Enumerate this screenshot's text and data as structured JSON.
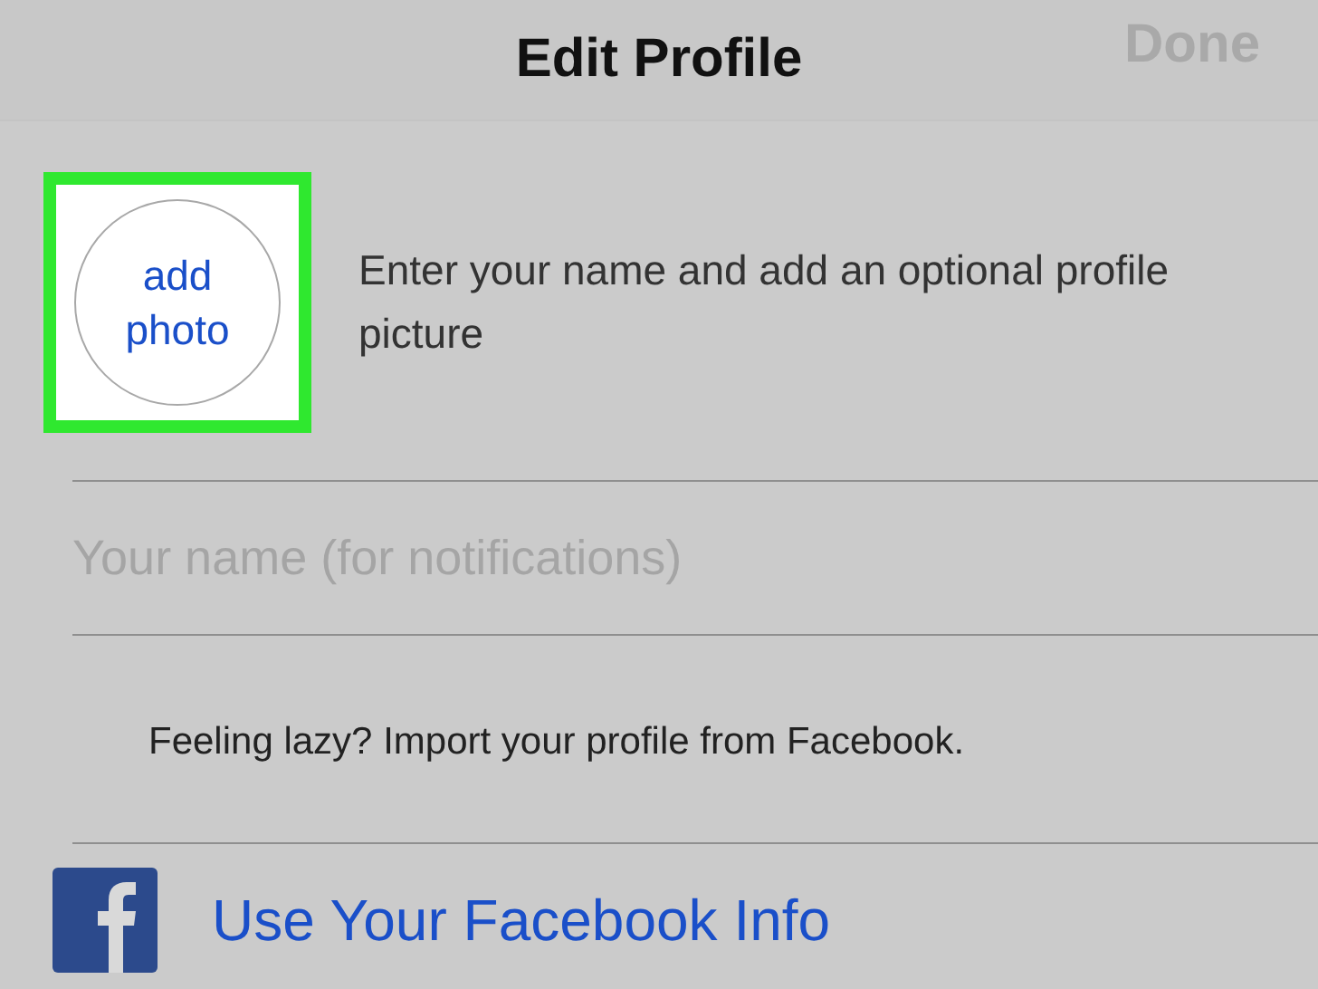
{
  "nav_bar": {
    "title": "Edit Profile",
    "done": {
      "label": "Done",
      "disabled": true
    }
  },
  "profile": {
    "photo_button": {
      "label_line_1": "add",
      "label_line_2": "photo",
      "highlighted": true
    },
    "hint": "Enter your name and add an optional profile picture"
  },
  "name_field": {
    "placeholder": "Your name (for notifications)"
  },
  "import_hint": "Feeling lazy? Import your profile from Facebook.",
  "facebook_button": {
    "label": "Use Your Facebook Info"
  }
}
